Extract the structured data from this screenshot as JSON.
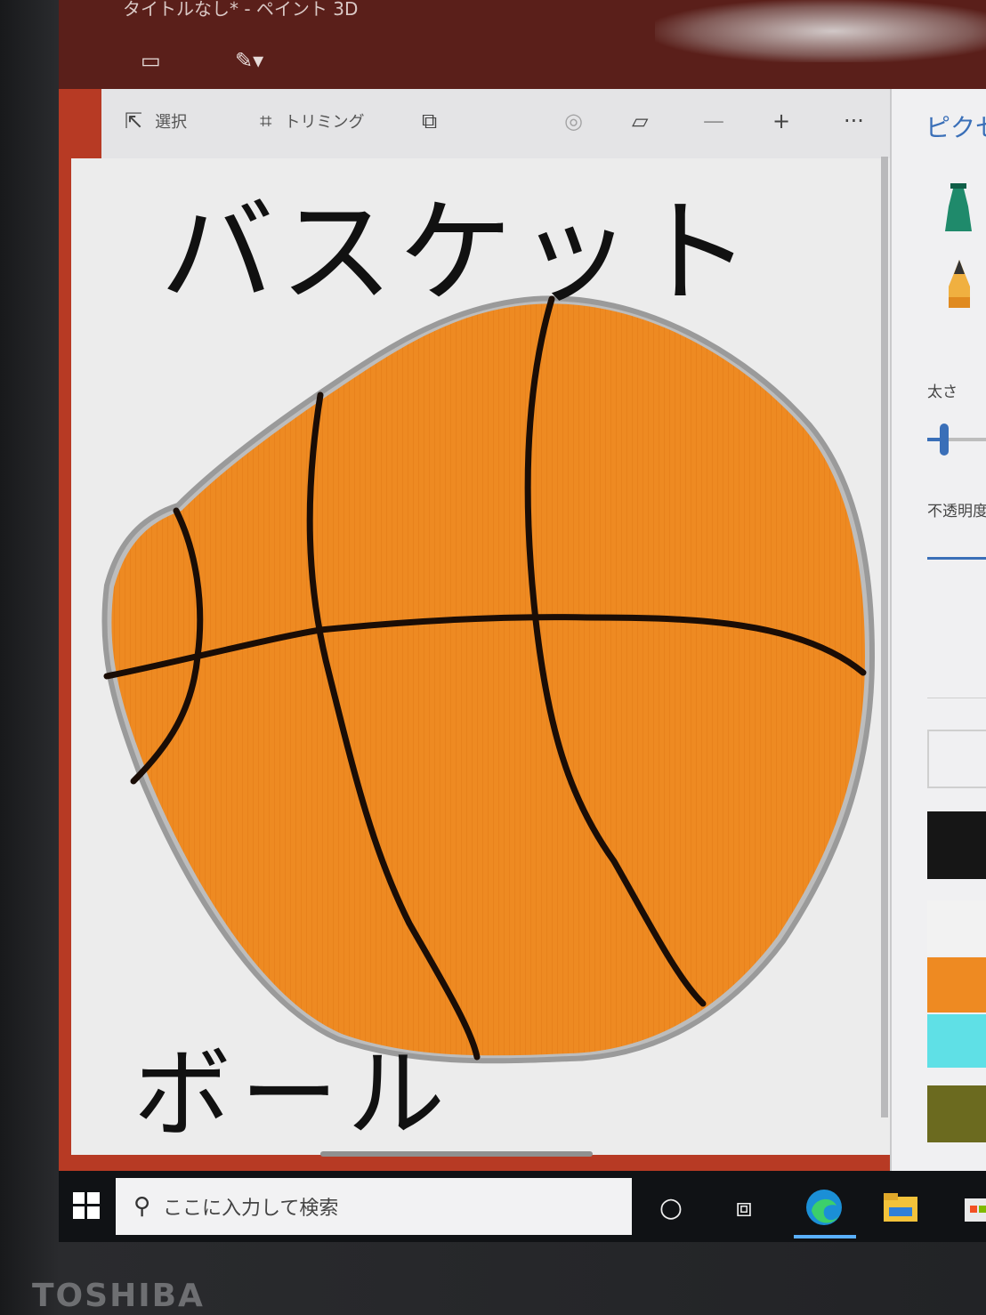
{
  "window": {
    "title": "タイトルなし* - ペイント 3D"
  },
  "toolbar": {
    "select_label": "選択",
    "crop_label": "トリミング",
    "zoom_out_glyph": "—",
    "zoom_in_glyph": "+",
    "more_glyph": "···"
  },
  "canvas": {
    "text_top": "バスケット",
    "text_bottom": "ボール",
    "ball_color": "#ee8a22"
  },
  "panel": {
    "title": "ピクセ",
    "thickness_label": "太さ",
    "opacity_label": "不透明度",
    "palette": [
      "#ffffff",
      "#161616",
      "#f2f2f2",
      "#ee8a22",
      "#5fe0e6",
      "#6b6a1f"
    ]
  },
  "taskbar": {
    "search_placeholder": "ここに入力して検索"
  },
  "device": {
    "brand": "TOSHIBA"
  },
  "colors": {
    "accent_blue": "#3a6fb8",
    "frame_red": "#b73a24",
    "titlebar": "#5a1f1a"
  }
}
